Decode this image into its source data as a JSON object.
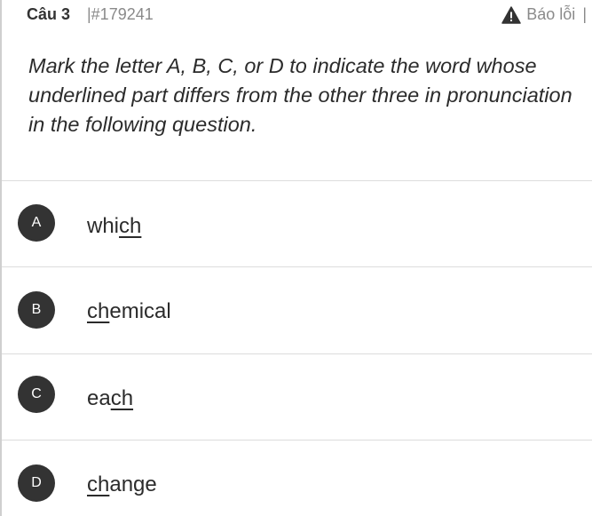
{
  "header": {
    "question_number": "Câu 3",
    "question_id": "|#179241",
    "report_label": "Báo lỗi",
    "report_separator": "|",
    "report_icon": "warning-triangle-icon"
  },
  "question": {
    "text": "Mark the letter A, B, C, or D to indicate the word whose underlined part differs from the other three in pronunciation in the following question."
  },
  "options": [
    {
      "letter": "A",
      "before": "whi",
      "underlined": "ch",
      "after": ""
    },
    {
      "letter": "B",
      "before": "",
      "underlined": "ch",
      "after": "emical"
    },
    {
      "letter": "C",
      "before": "ea",
      "underlined": "ch",
      "after": ""
    },
    {
      "letter": "D",
      "before": "",
      "underlined": "ch",
      "after": "ange"
    }
  ],
  "colors": {
    "badge_bg": "#333333",
    "warning": "#333333",
    "muted_text": "#8a8a8a",
    "divider": "#dcdcdc"
  }
}
